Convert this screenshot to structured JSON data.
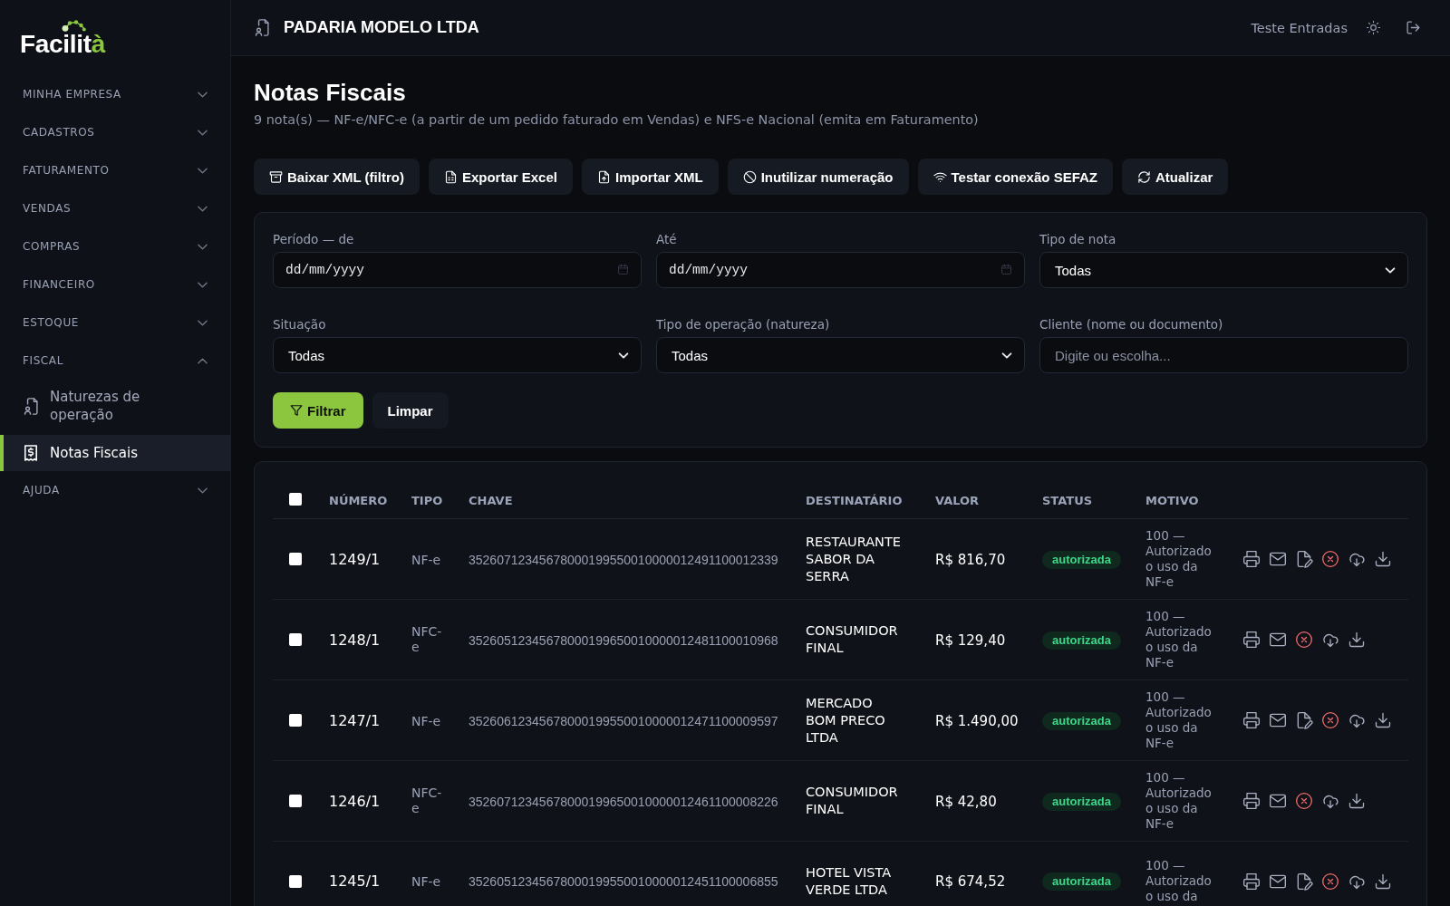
{
  "sidebar": {
    "logo": {
      "text": "Facilit",
      "accent": "à"
    },
    "items": [
      {
        "label": "MINHA EMPRESA",
        "expanded": false
      },
      {
        "label": "CADASTROS",
        "expanded": false
      },
      {
        "label": "FATURAMENTO",
        "expanded": false
      },
      {
        "label": "VENDAS",
        "expanded": false
      },
      {
        "label": "COMPRAS",
        "expanded": false
      },
      {
        "label": "FINANCEIRO",
        "expanded": false
      },
      {
        "label": "ESTOQUE",
        "expanded": false
      },
      {
        "label": "FISCAL",
        "expanded": true,
        "children": [
          {
            "label": "Naturezas de operação",
            "selected": false
          },
          {
            "label": "Notas Fiscais",
            "selected": true
          }
        ]
      },
      {
        "label": "AJUDA",
        "expanded": false
      }
    ]
  },
  "header": {
    "company": "PADARIA MODELO LTDA",
    "user": "Teste Entradas"
  },
  "page": {
    "title": "Notas Fiscais",
    "subtitle": "9 nota(s) — NF-e/NFC-e (a partir de um pedido faturado em Vendas) e NFS-e Nacional (emita em Faturamento)"
  },
  "toolbar": [
    "Baixar XML (filtro)",
    "Exportar Excel",
    "Importar XML",
    "Inutilizar numeração",
    "Testar conexão SEFAZ",
    "Atualizar"
  ],
  "filters": {
    "fields": [
      {
        "label": "Período — de",
        "kind": "date",
        "placeholder": "dd/mm/yyyy"
      },
      {
        "label": "Até",
        "kind": "date",
        "placeholder": "dd/mm/yyyy"
      },
      {
        "label": "Tipo de nota",
        "kind": "select",
        "value": "Todas"
      },
      {
        "label": "Situação",
        "kind": "select",
        "value": "Todas"
      },
      {
        "label": "Tipo de operação (natureza)",
        "kind": "select",
        "value": "Todas"
      },
      {
        "label": "Cliente (nome ou documento)",
        "kind": "text",
        "placeholder": "Digite ou escolha..."
      }
    ],
    "buttons": [
      {
        "label": "Filtrar",
        "kind": "primary"
      },
      {
        "label": "Limpar",
        "kind": "secondary"
      }
    ]
  },
  "table": {
    "select_all": {
      "checked": false
    },
    "columns": [
      "NÚMERO",
      "TIPO",
      "CHAVE",
      "DESTINATÁRIO",
      "VALOR",
      "STATUS",
      "MOTIVO"
    ],
    "rows": [
      {
        "checked": false,
        "numero": "1249/1",
        "tipo": "NF-e",
        "chave": "35260712345678000199550010000012491100012339",
        "destinatario": "RESTAURANTE SABOR DA SERRA",
        "valor": "R$ 816,70",
        "status": "autorizada",
        "motivo": "100 — Autorizado o uso da NF-e",
        "actions": [
          {
            "kind": "print"
          },
          {
            "kind": "email"
          },
          {
            "kind": "edit"
          },
          {
            "kind": "cancel"
          },
          {
            "kind": "cloud"
          },
          {
            "kind": "download"
          }
        ]
      },
      {
        "checked": false,
        "numero": "1248/1",
        "tipo": "NFC-e",
        "chave": "35260512345678000199650010000012481100010968",
        "destinatario": "CONSUMIDOR FINAL",
        "valor": "R$ 129,40",
        "status": "autorizada",
        "motivo": "100 — Autorizado o uso da NF-e",
        "actions": [
          {
            "kind": "print"
          },
          {
            "kind": "email"
          },
          {
            "kind": "cancel"
          },
          {
            "kind": "cloud"
          },
          {
            "kind": "download"
          }
        ]
      },
      {
        "checked": false,
        "numero": "1247/1",
        "tipo": "NF-e",
        "chave": "35260612345678000199550010000012471100009597",
        "destinatario": "MERCADO BOM PRECO LTDA",
        "valor": "R$ 1.490,00",
        "status": "autorizada",
        "motivo": "100 — Autorizado o uso da NF-e",
        "actions": [
          {
            "kind": "print"
          },
          {
            "kind": "email"
          },
          {
            "kind": "edit"
          },
          {
            "kind": "cancel"
          },
          {
            "kind": "cloud"
          },
          {
            "kind": "download"
          }
        ]
      },
      {
        "checked": false,
        "numero": "1246/1",
        "tipo": "NFC-e",
        "chave": "35260712345678000199650010000012461100008226",
        "destinatario": "CONSUMIDOR FINAL",
        "valor": "R$ 42,80",
        "status": "autorizada",
        "motivo": "100 — Autorizado o uso da NF-e",
        "actions": [
          {
            "kind": "print"
          },
          {
            "kind": "email"
          },
          {
            "kind": "cancel"
          },
          {
            "kind": "cloud"
          },
          {
            "kind": "download"
          }
        ]
      },
      {
        "checked": false,
        "numero": "1245/1",
        "tipo": "NF-e",
        "chave": "35260512345678000199550010000012451100006855",
        "destinatario": "HOTEL VISTA VERDE LTDA",
        "valor": "R$ 674,52",
        "status": "autorizada",
        "motivo": "100 — Autorizado o uso da",
        "actions": [
          {
            "kind": "print"
          },
          {
            "kind": "email"
          },
          {
            "kind": "edit"
          },
          {
            "kind": "cancel"
          },
          {
            "kind": "cloud"
          },
          {
            "kind": "download"
          }
        ]
      }
    ]
  }
}
